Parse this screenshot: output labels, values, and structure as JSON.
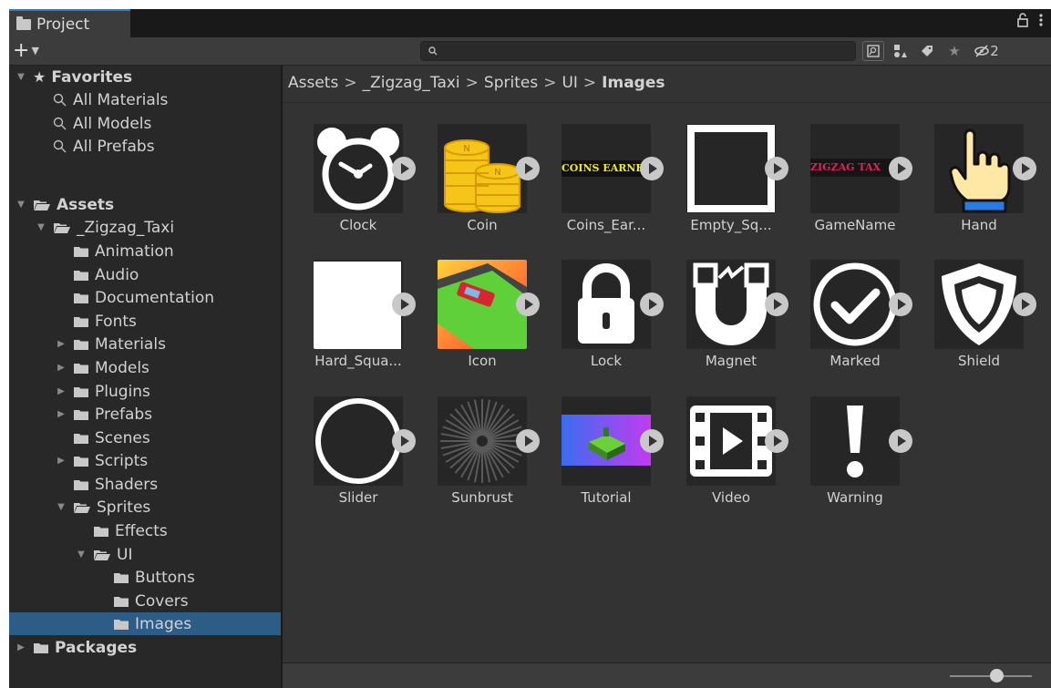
{
  "window": {
    "tab_label": "Project",
    "lock_icon": "lock-icon",
    "menu_icon": "kebab-menu-icon"
  },
  "toolbar": {
    "add_label": "+",
    "search_placeholder": "",
    "hidden_packages_count": "2"
  },
  "tree": {
    "items": [
      {
        "label": "Favorites",
        "depth": 0,
        "expanded": true,
        "icon": "star-icon",
        "bold": true
      },
      {
        "label": "All Materials",
        "depth": 1,
        "icon": "search-icon"
      },
      {
        "label": "All Models",
        "depth": 1,
        "icon": "search-icon"
      },
      {
        "label": "All Prefabs",
        "depth": 1,
        "icon": "search-icon"
      },
      {
        "label": "Assets",
        "depth": 0,
        "expanded": true,
        "icon": "folder-open-icon",
        "bold": true
      },
      {
        "label": "_Zigzag_Taxi",
        "depth": 1,
        "expanded": true,
        "icon": "folder-open-icon"
      },
      {
        "label": "Animation",
        "depth": 2,
        "icon": "folder-icon"
      },
      {
        "label": "Audio",
        "depth": 2,
        "icon": "folder-icon"
      },
      {
        "label": "Documentation",
        "depth": 2,
        "icon": "folder-icon"
      },
      {
        "label": "Fonts",
        "depth": 2,
        "icon": "folder-icon"
      },
      {
        "label": "Materials",
        "depth": 2,
        "collapsed": true,
        "icon": "folder-icon"
      },
      {
        "label": "Models",
        "depth": 2,
        "collapsed": true,
        "icon": "folder-icon"
      },
      {
        "label": "Plugins",
        "depth": 2,
        "collapsed": true,
        "icon": "folder-icon"
      },
      {
        "label": "Prefabs",
        "depth": 2,
        "collapsed": true,
        "icon": "folder-icon"
      },
      {
        "label": "Scenes",
        "depth": 2,
        "icon": "folder-icon"
      },
      {
        "label": "Scripts",
        "depth": 2,
        "collapsed": true,
        "icon": "folder-icon"
      },
      {
        "label": "Shaders",
        "depth": 2,
        "icon": "folder-icon"
      },
      {
        "label": "Sprites",
        "depth": 2,
        "expanded": true,
        "icon": "folder-open-icon"
      },
      {
        "label": "Effects",
        "depth": 3,
        "icon": "folder-icon"
      },
      {
        "label": "UI",
        "depth": 3,
        "expanded": true,
        "icon": "folder-open-icon"
      },
      {
        "label": "Buttons",
        "depth": 4,
        "icon": "folder-icon"
      },
      {
        "label": "Covers",
        "depth": 4,
        "icon": "folder-icon"
      },
      {
        "label": "Images",
        "depth": 4,
        "icon": "folder-icon",
        "selected": true
      },
      {
        "label": "Packages",
        "depth": 0,
        "collapsed": true,
        "icon": "folder-icon",
        "bold": true
      }
    ]
  },
  "breadcrumb": {
    "segments": [
      "Assets",
      "_Zigzag_Taxi",
      "Sprites",
      "UI",
      "Images"
    ],
    "separator": ">"
  },
  "assets": [
    {
      "label": "Clock",
      "icon": "clock-icon"
    },
    {
      "label": "Coin",
      "icon": "coin-stack-icon"
    },
    {
      "label": "Coins_Ear...",
      "icon": "coins-earned-text-icon",
      "thumb_text": "COINS EARNE"
    },
    {
      "label": "Empty_Sq...",
      "icon": "empty-square-icon"
    },
    {
      "label": "GameName",
      "icon": "game-name-text-icon",
      "thumb_text": "ZIGZAG TAX"
    },
    {
      "label": "Hand",
      "icon": "hand-pointer-icon"
    },
    {
      "label": "Hard_Squa...",
      "icon": "hard-square-icon"
    },
    {
      "label": "Icon",
      "icon": "app-icon"
    },
    {
      "label": "Lock",
      "icon": "padlock-icon"
    },
    {
      "label": "Magnet",
      "icon": "magnet-icon"
    },
    {
      "label": "Marked",
      "icon": "checkmark-circle-icon"
    },
    {
      "label": "Shield",
      "icon": "shield-icon"
    },
    {
      "label": "Slider",
      "icon": "ring-icon"
    },
    {
      "label": "Sunbrust",
      "icon": "sunburst-icon"
    },
    {
      "label": "Tutorial",
      "icon": "tutorial-image-icon"
    },
    {
      "label": "Video",
      "icon": "film-play-icon"
    },
    {
      "label": "Warning",
      "icon": "exclamation-icon"
    }
  ],
  "zoom": {
    "level": 0.5
  }
}
